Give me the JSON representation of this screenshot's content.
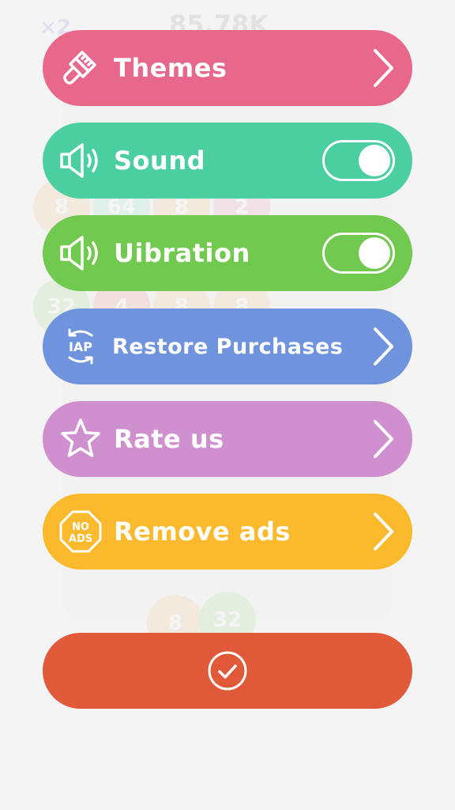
{
  "background": {
    "multiplier": "×2",
    "score": "85.78K",
    "tiles": [
      "8",
      "64",
      "8",
      "2",
      "32",
      "4",
      "8",
      "8",
      "8",
      "32"
    ]
  },
  "menu": {
    "items": [
      {
        "label": "Themes",
        "icon": "paintbrush-icon",
        "color": "#e8688c",
        "control": "chevron"
      },
      {
        "label": "Sound",
        "icon": "speaker-icon",
        "color": "#4ccfa0",
        "control": "toggle",
        "value": "on"
      },
      {
        "label": "Uibration",
        "icon": "speaker-icon",
        "color": "#72c94f",
        "control": "toggle",
        "value": "on"
      },
      {
        "label": "Restore Purchases",
        "icon": "iap-restore-icon",
        "icon_text": "IAP",
        "color": "#6f93dc",
        "control": "chevron"
      },
      {
        "label": "Rate us",
        "icon": "star-icon",
        "color": "#d08fcf",
        "control": "chevron"
      },
      {
        "label": "Remove ads",
        "icon": "no-ads-icon",
        "icon_text_top": "NO",
        "icon_text_bottom": "ADS",
        "color": "#fbba2d",
        "control": "chevron"
      }
    ]
  },
  "confirm": {
    "icon": "checkmark-icon",
    "color": "#e05a3a"
  }
}
